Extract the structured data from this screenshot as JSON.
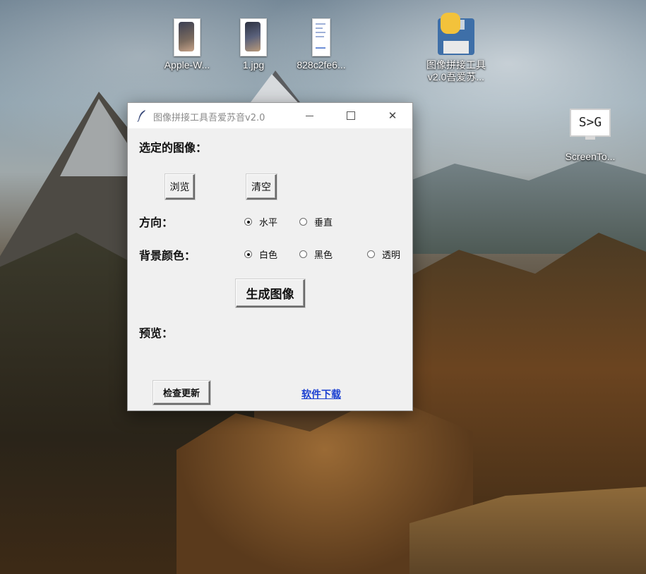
{
  "desktop": {
    "icons": [
      {
        "label": "Apple-W..."
      },
      {
        "label": "1.jpg"
      },
      {
        "label": "828c2fe6..."
      },
      {
        "label_line1": "图像拼接工具",
        "label_line2": "v2.0吾爱苏..."
      },
      {
        "label": "ScreenTo...",
        "monitor_text": "S>G"
      }
    ]
  },
  "window": {
    "title": "图像拼接工具吾爱苏音v2.0",
    "controls": {
      "minimize": "–",
      "maximize": "□",
      "close": "✕"
    }
  },
  "main": {
    "selected_label": "选定的图像：",
    "browse_button": "浏览",
    "clear_button": "清空",
    "direction_label": "方向：",
    "direction_options": [
      {
        "label": "水平",
        "selected": true
      },
      {
        "label": "垂直",
        "selected": false
      }
    ],
    "bg_label": "背景颜色：",
    "bg_options": [
      {
        "label": "白色",
        "selected": true
      },
      {
        "label": "黑色",
        "selected": false
      },
      {
        "label": "透明",
        "selected": false
      }
    ],
    "generate_button": "生成图像",
    "preview_label": "预览：",
    "update_button": "检查更新",
    "download_link": "软件下载"
  },
  "colors": {
    "window_bg": "#f0f0f0",
    "link": "#1a3fd1",
    "title_text": "#8a8a8a"
  }
}
